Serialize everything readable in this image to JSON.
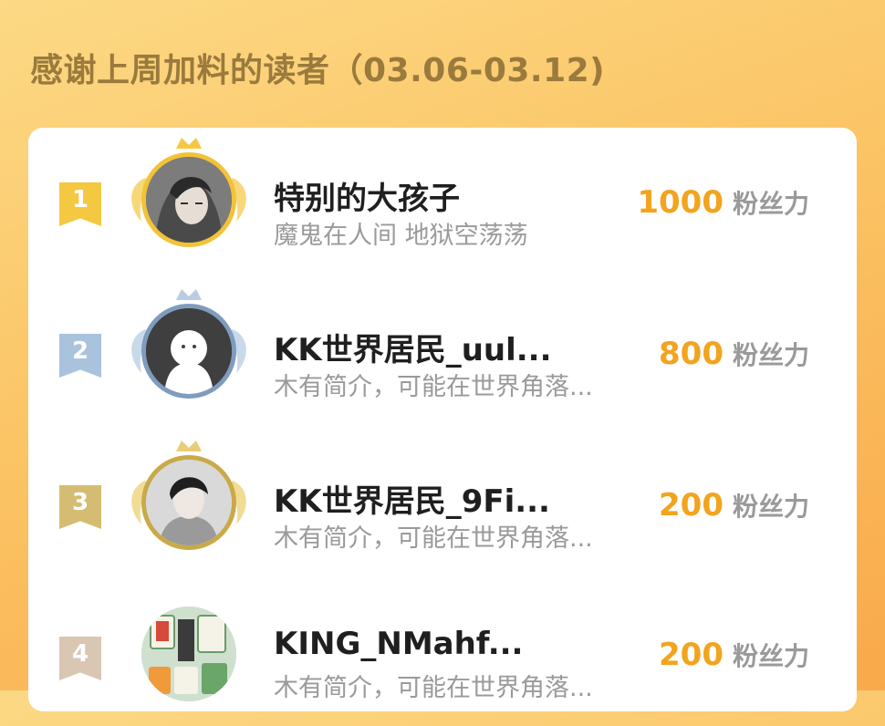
{
  "page": {
    "title": "感谢上周加料的读者（03.06-03.12)"
  },
  "colors": {
    "gold": "#f2c94c",
    "silver": "#a9c3dd",
    "bronze": "#d4bd72",
    "rank4": "#d9c6b3",
    "score": "#f2a41e"
  },
  "readers": [
    {
      "rank": "1",
      "name": "特别的大孩子",
      "bio": "魔鬼在人间 地狱空荡荡",
      "score": "1000",
      "unit": "粉丝力",
      "avatar_icon": "dark-haired-character-avatar-icon"
    },
    {
      "rank": "2",
      "name": "KK世界居民_uul...",
      "bio": "木有简介，可能在世界角落...",
      "score": "800",
      "unit": "粉丝力",
      "avatar_icon": "default-ghost-avatar-icon"
    },
    {
      "rank": "3",
      "name": "KK世界居民_9Fi...",
      "bio": "木有简介，可能在世界角落...",
      "score": "200",
      "unit": "粉丝力",
      "avatar_icon": "boy-photo-avatar-icon"
    },
    {
      "rank": "4",
      "name": "KING_NMahf...",
      "bio": "木有简介，可能在世界角落...",
      "score": "200",
      "unit": "粉丝力",
      "avatar_icon": "mahjong-tiles-avatar-icon"
    }
  ]
}
